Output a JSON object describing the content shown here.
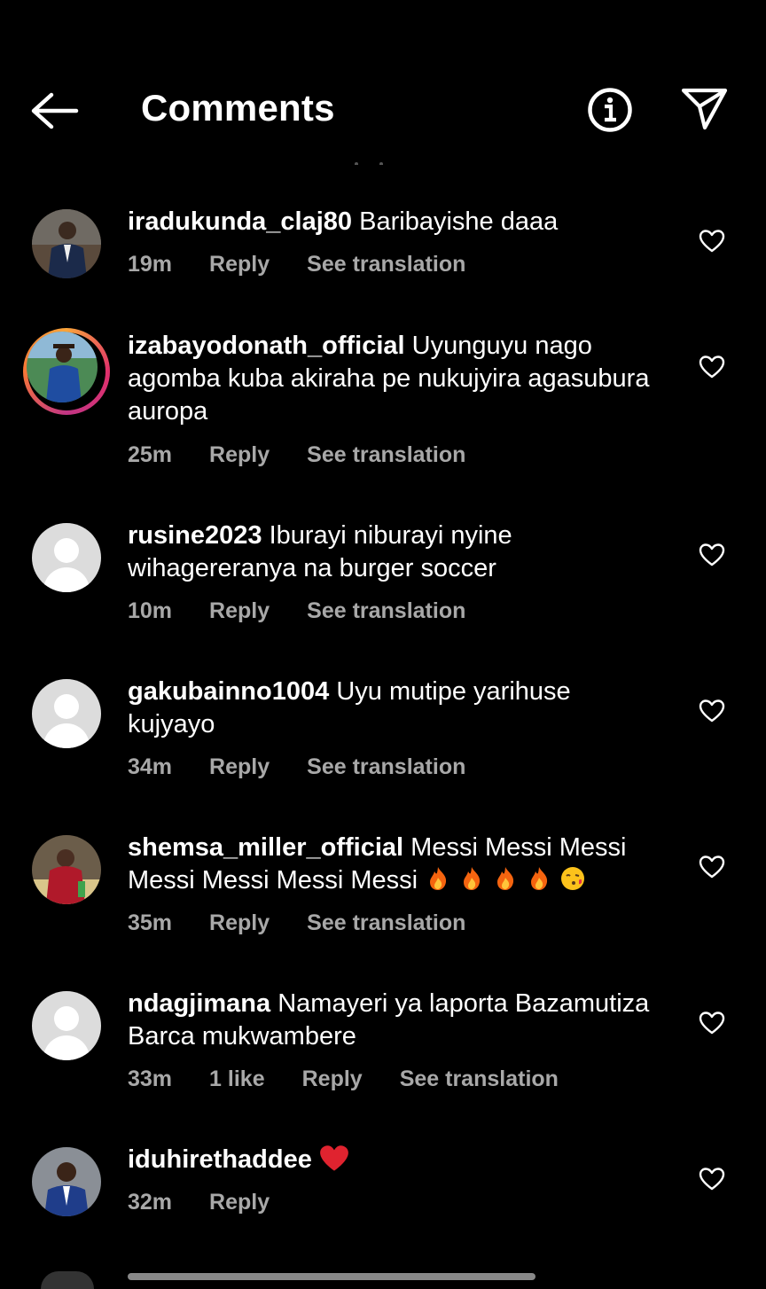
{
  "header": {
    "title": "Comments"
  },
  "comments": [
    {
      "username": "iradukunda_claj80",
      "text": "Baribayishe daaa",
      "time": "19m",
      "likes": "",
      "reply": "Reply",
      "translate": "See translation",
      "avatar": "photo-man-suit"
    },
    {
      "username": "izabayodonath_official",
      "text": "Uyunguyu nago agomba kuba akiraha pe nukujyira agasubura auropa",
      "time": "25m",
      "likes": "",
      "reply": "Reply",
      "translate": "See translation",
      "avatar": "photo-story-ring"
    },
    {
      "username": "rusine2023",
      "text": "Iburayi niburayi nyine wihagereranya na burger soccer",
      "time": "10m",
      "likes": "",
      "reply": "Reply",
      "translate": "See translation",
      "avatar": "default-avatar"
    },
    {
      "username": "gakubainno1004",
      "text": "Uyu mutipe yarihuse kujyayo",
      "time": "34m",
      "likes": "",
      "reply": "Reply",
      "translate": "See translation",
      "avatar": "default-avatar"
    },
    {
      "username": "shemsa_miller_official",
      "text": "Messi Messi Messi Messi Messi Messi Messi",
      "emojis": [
        "fire",
        "fire",
        "fire",
        "fire",
        "kiss"
      ],
      "time": "35m",
      "likes": "",
      "reply": "Reply",
      "translate": "See translation",
      "avatar": "photo-woman-red"
    },
    {
      "username": "ndagjimana",
      "text": "Namayeri  ya laporta Bazamutiza Barca  mukwambere",
      "time": "33m",
      "likes": "1 like",
      "reply": "Reply",
      "translate": "See translation",
      "avatar": "default-avatar"
    },
    {
      "username": "iduhirethaddee",
      "text": "",
      "emojis": [
        "red-heart"
      ],
      "time": "32m",
      "likes": "",
      "reply": "Reply",
      "translate": "",
      "avatar": "photo-man-blue"
    }
  ],
  "icons": {
    "back": "arrow-left-icon",
    "info": "info-icon",
    "send": "paper-plane-icon",
    "like": "heart-outline-icon"
  },
  "colors": {
    "background": "#000000",
    "text": "#ffffff",
    "meta": "#a8a8a8",
    "default_avatar": "#dcdcdc"
  }
}
